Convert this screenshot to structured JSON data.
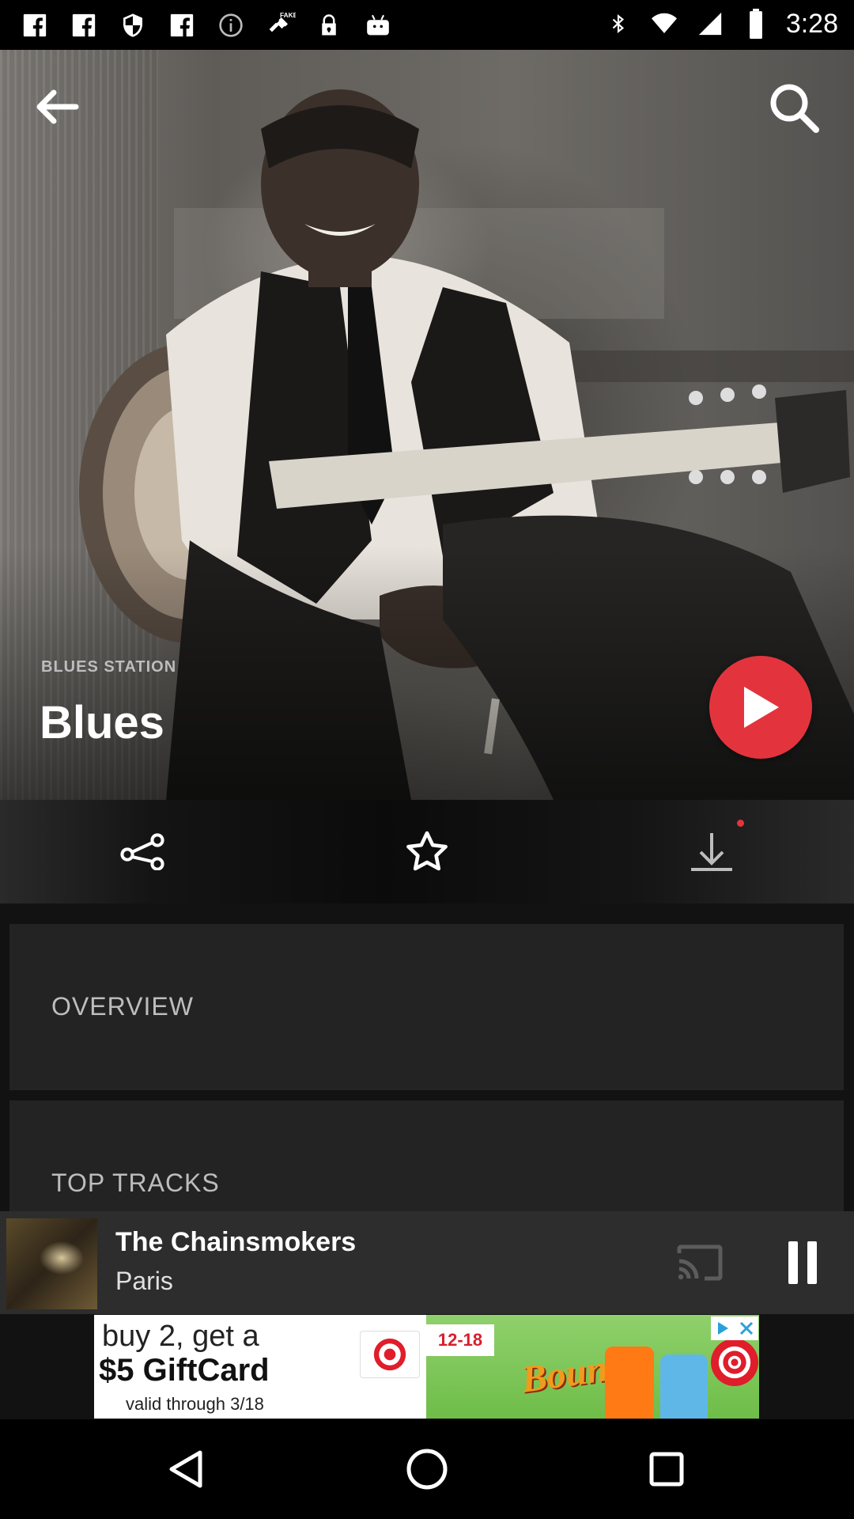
{
  "status_bar": {
    "time": "3:28",
    "icons": [
      "facebook-icon",
      "facebook-icon",
      "shield-icon",
      "facebook-icon",
      "info-icon",
      "fake-gps-icon",
      "lock-icon",
      "android-icon",
      "bluetooth-icon",
      "wifi-icon",
      "signal-icon",
      "battery-icon"
    ]
  },
  "header": {
    "back_icon": "back-arrow-icon",
    "search_icon": "search-icon"
  },
  "station": {
    "label": "BLUES STATION",
    "title": "Blues"
  },
  "actions": {
    "share_icon": "share-icon",
    "favorite_icon": "star-icon",
    "download_icon": "download-icon"
  },
  "sections": {
    "overview": "OVERVIEW",
    "top_tracks": "TOP TRACKS"
  },
  "now_playing": {
    "artist": "The Chainsmokers",
    "title": "Paris"
  },
  "ad": {
    "line1": "buy 2, get a",
    "line2": "$5 GiftCard",
    "line3": "valid through 3/18",
    "price_tag": "12-18",
    "brand": "Bounty"
  },
  "colors": {
    "accent": "#e3343d",
    "card_bg": "#232323",
    "player_bg": "#2d2d2d"
  }
}
